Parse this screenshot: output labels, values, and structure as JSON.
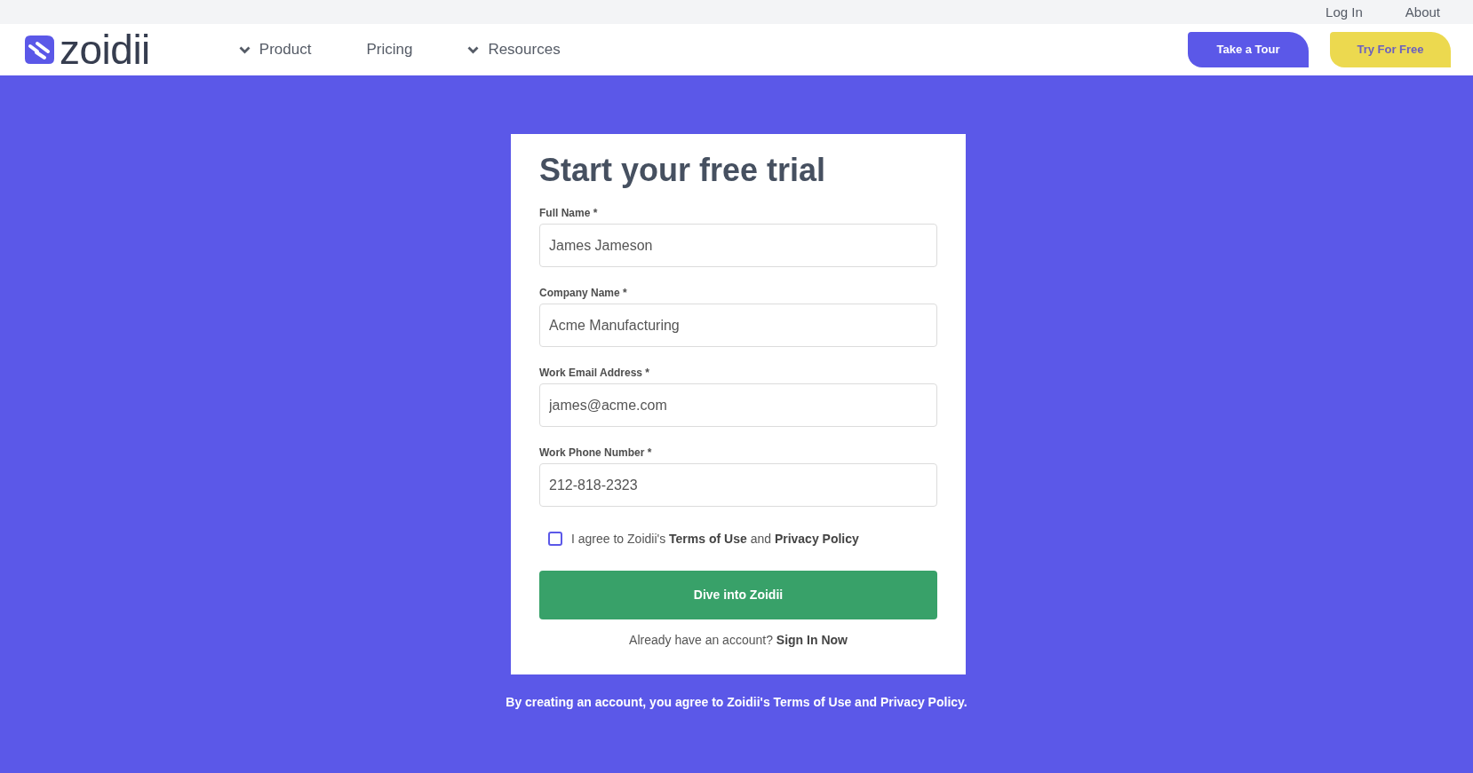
{
  "top_bar": {
    "links": [
      "Log In",
      "About"
    ]
  },
  "header": {
    "logo": {
      "text": "zoidii"
    },
    "nav": [
      {
        "label": "Product",
        "dropdown": true
      },
      {
        "label": "Pricing",
        "dropdown": false
      },
      {
        "label": "Resources",
        "dropdown": true
      }
    ],
    "buttons": [
      {
        "label": "Take a Tour",
        "kind": "primary"
      },
      {
        "label": "Try For Free",
        "kind": "accent"
      }
    ]
  },
  "form": {
    "title": "Start your free trial",
    "fields": [
      {
        "label": "Full Name *",
        "value": "James Jameson"
      },
      {
        "label": "Company Name *",
        "value": "Acme Manufacturing"
      },
      {
        "label": "Work Email Address *",
        "value": "james@acme.com"
      },
      {
        "label": "Work Phone Number *",
        "value": "212-818-2323"
      }
    ],
    "agreement": {
      "checked": false,
      "parts": [
        {
          "kind": "text",
          "text": "I agree to Zoidii's"
        },
        {
          "kind": "link",
          "text": "Terms of Use"
        },
        {
          "kind": "text",
          "text": "and"
        },
        {
          "kind": "link",
          "text": "Privacy Policy"
        }
      ]
    },
    "submit": "Dive into Zoidii",
    "signin": {
      "prompt": "Already have an account?",
      "link": "Sign In Now"
    }
  },
  "footer_note": "By creating an account, you agree to Zoidii's Terms of Use and Privacy Policy."
}
